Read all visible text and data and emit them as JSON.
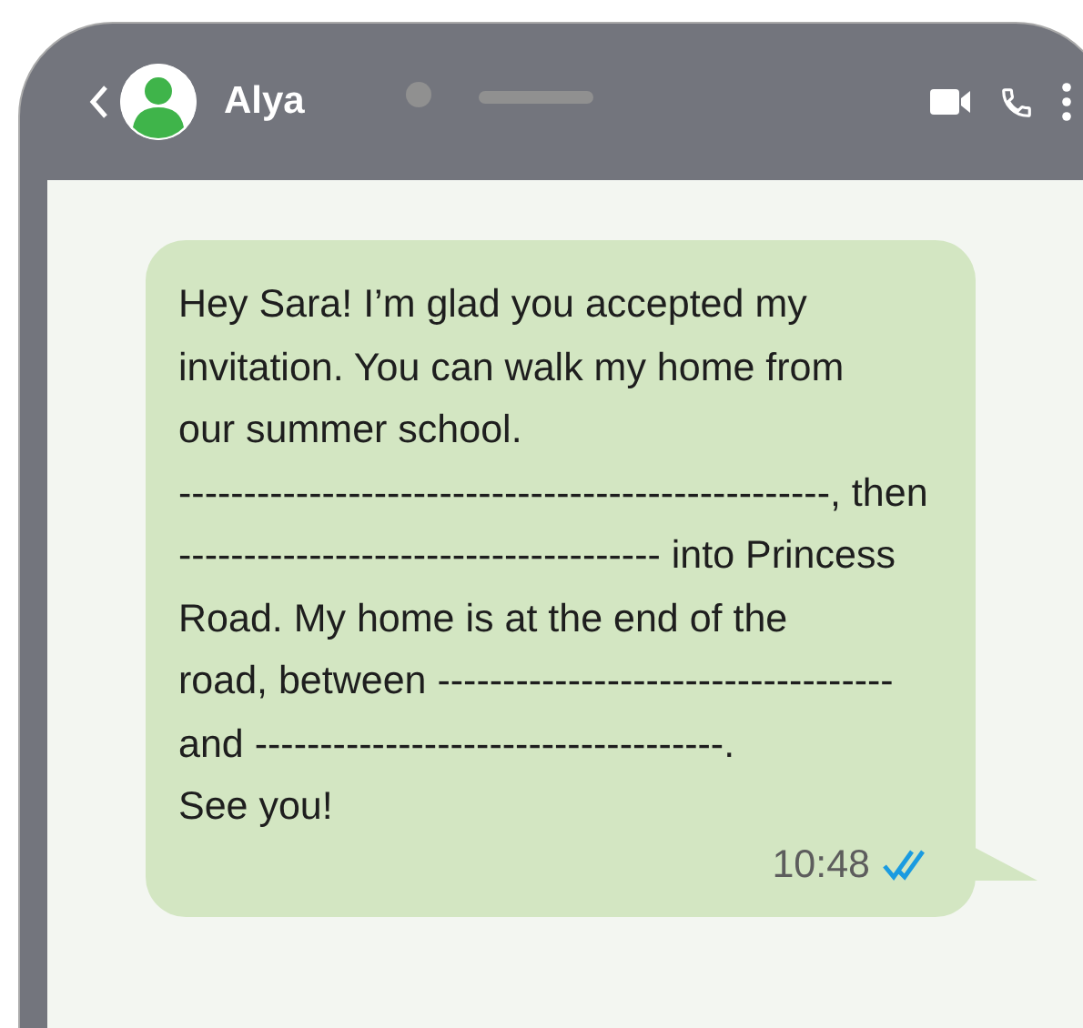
{
  "header": {
    "contact_name": "Alya"
  },
  "message": {
    "text": "Hey Sara! I’m glad you accepted my\ninvitation. You can walk my home from\nour summer school.\n--------------------------------------------------, then\n------------------------------------- into Princess\nRoad. My home is at the end of the\nroad, between -----------------------------------\nand ------------------------------------.\nSee you!",
    "time": "10:48",
    "read": true
  }
}
